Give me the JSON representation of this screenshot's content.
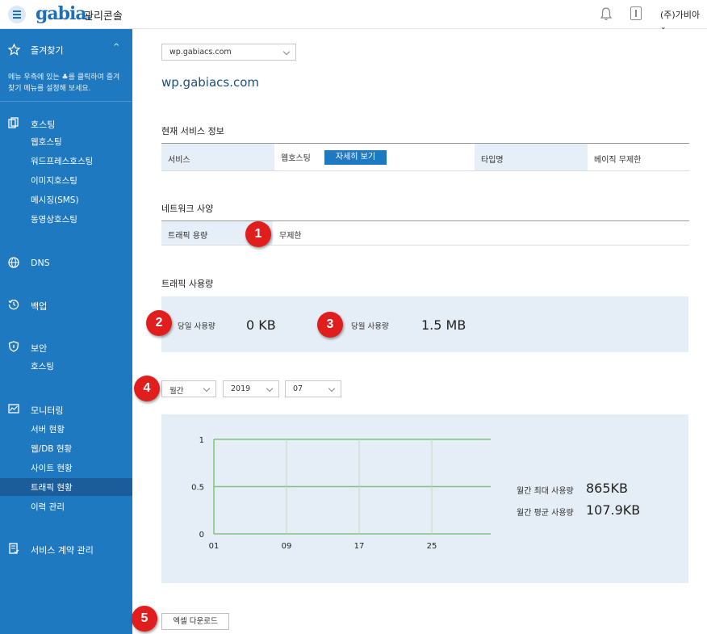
{
  "header": {
    "logo": "gabia.",
    "console_label": "관리콘솔",
    "user": "(주)가비아"
  },
  "sidebar": {
    "favorites_label": "즐겨찾기",
    "favorites_desc": "메뉴 우측에 있는 ♣를 클릭하여 즐겨찾기 메뉴를 설정해 보세요.",
    "hosting": {
      "label": "호스팅",
      "items": [
        "웹호스팅",
        "워드프레스호스팅",
        "이미지호스팅",
        "메시징(SMS)",
        "동영상호스팅"
      ]
    },
    "dns": {
      "label": "DNS"
    },
    "backup": {
      "label": "백업"
    },
    "security": {
      "label": "보안",
      "items": [
        "호스팅"
      ]
    },
    "monitoring": {
      "label": "모니터링",
      "items": [
        "서버 현황",
        "웹/DB 현황",
        "사이트 현황",
        "트래픽 현황",
        "이력 관리"
      ],
      "active": "트래픽 현황"
    },
    "contract": {
      "label": "서비스 계약 관리"
    }
  },
  "main": {
    "domain_select": "wp.gabiacs.com",
    "domain_title": "wp.gabiacs.com",
    "service_info": {
      "title": "현재 서비스 정보",
      "service_label": "서비스",
      "service_value": "웹호스팅",
      "detail_button": "자세히 보기",
      "type_label": "타입명",
      "type_value": "베이직 무제한"
    },
    "network": {
      "title": "네트워크 사양",
      "traffic_label": "트래픽 용량",
      "traffic_value": "무제한"
    },
    "usage": {
      "title": "트래픽 사용량",
      "today_label": "당일 사용량",
      "today_value": "0 KB",
      "month_label": "당월 사용량",
      "month_value": "1.5 MB"
    },
    "filters": {
      "period": "월간",
      "year": "2019",
      "month": "07"
    },
    "stats": {
      "max_label": "월간 최대 사용량",
      "max_value": "865KB",
      "avg_label": "월간 평균 사용량",
      "avg_value": "107.9KB"
    },
    "excel_button": "엑셀 다운로드"
  },
  "markers": [
    "1",
    "2",
    "3",
    "4",
    "5"
  ],
  "colors": {
    "sidebar": "#1f79c0",
    "sidebar_active": "#1b5c9b",
    "panel": "#e5eef6",
    "line": "#7fc27f",
    "marker": "#e01e1e"
  },
  "chart_data": {
    "type": "line",
    "x_tick_labels": [
      "01",
      "09",
      "17",
      "25"
    ],
    "y_tick_labels": [
      "1",
      "0.5",
      "0"
    ],
    "ylim": [
      0,
      1
    ],
    "grid": true,
    "series": [
      {
        "values": []
      }
    ]
  }
}
